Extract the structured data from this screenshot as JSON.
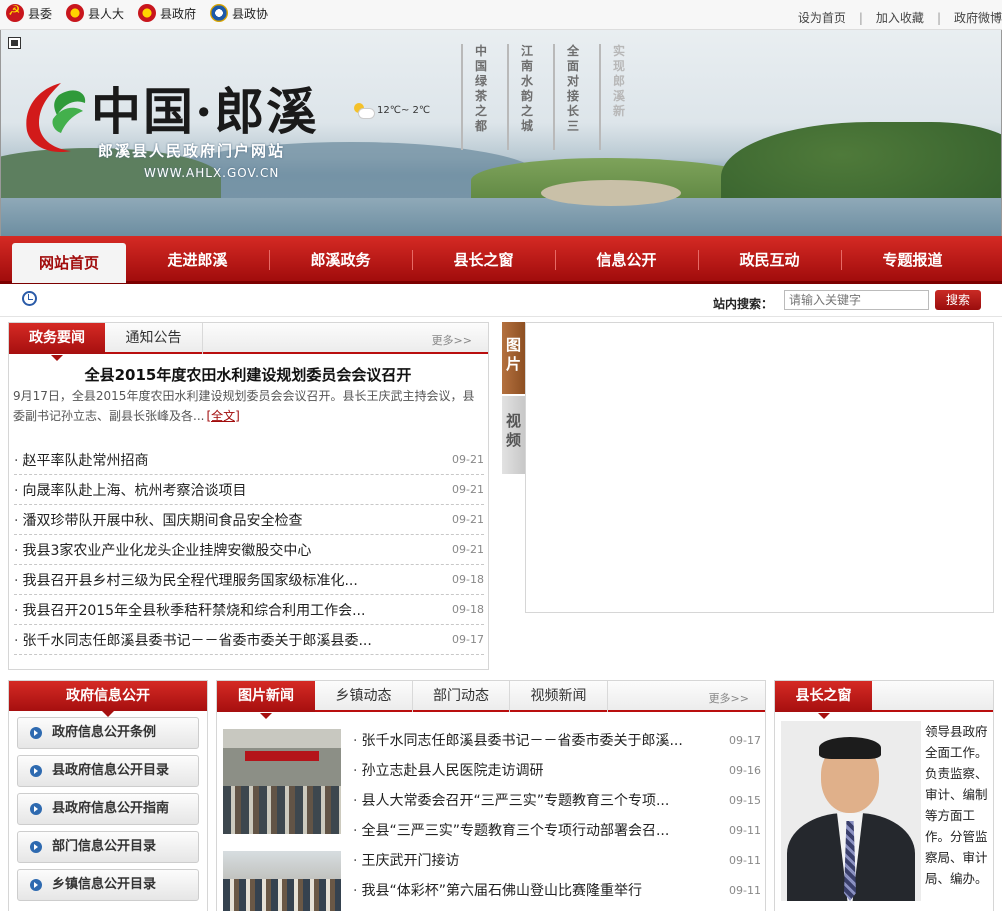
{
  "top_links": [
    {
      "label": "县委",
      "icon": "party-emblem-icon"
    },
    {
      "label": "县人大",
      "icon": "national-emblem-icon"
    },
    {
      "label": "县政府",
      "icon": "national-emblem-icon"
    },
    {
      "label": "县政协",
      "icon": "cppcc-emblem-icon"
    }
  ],
  "top_right": {
    "home": "设为首页",
    "favorite": "加入收藏",
    "weibo": "政府微博"
  },
  "banner": {
    "title": "中国·郎溪",
    "subtitle": "郎溪县人民政府门户网站",
    "url": "WWW.AHLX.GOV.CN",
    "weather": "12℃~ 2℃",
    "slogans": [
      "中国绿茶之都",
      "江南水韵之城",
      "全面对接长三",
      "实现郎溪新"
    ]
  },
  "nav": [
    "网站首页",
    "走进郎溪",
    "郎溪政务",
    "县长之窗",
    "信息公开",
    "政民互动",
    "专题报道"
  ],
  "search": {
    "label": "站内搜索：",
    "placeholder": "请输入关键字",
    "button": "搜索"
  },
  "news_panel": {
    "tabs": [
      "政务要闻",
      "通知公告"
    ],
    "more": "更多>>",
    "headline": "全县2015年度农田水利建设规划委员会会议召开",
    "summary": "9月17日，全县2015年度农田水利建设规划委员会会议召开。县长王庆武主持会议，县委副书记孙立志、副县长张峰及各...",
    "full_text": "[全文]",
    "items": [
      {
        "title": "赵平率队赴常州招商",
        "date": "09-21"
      },
      {
        "title": "向晟率队赴上海、杭州考察洽谈项目",
        "date": "09-21"
      },
      {
        "title": "潘双珍带队开展中秋、国庆期间食品安全检查",
        "date": "09-21"
      },
      {
        "title": "我县3家农业产业化龙头企业挂牌安徽股交中心",
        "date": "09-21"
      },
      {
        "title": "我县召开县乡村三级为民全程代理服务国家级标准化...",
        "date": "09-18"
      },
      {
        "title": "我县召开2015年全县秋季秸秆禁烧和综合利用工作会...",
        "date": "09-18"
      },
      {
        "title": "张千水同志任郎溪县委书记－－省委市委关于郎溪县委...",
        "date": "09-17"
      }
    ]
  },
  "media_tabs": [
    "图片",
    "视频"
  ],
  "gov_info": {
    "title": "政府信息公开",
    "items": [
      "政府信息公开条例",
      "县政府信息公开目录",
      "县政府信息公开指南",
      "部门信息公开目录",
      "乡镇信息公开目录"
    ]
  },
  "photo_news": {
    "tabs": [
      "图片新闻",
      "乡镇动态",
      "部门动态",
      "视频新闻"
    ],
    "more": "更多>>",
    "items": [
      {
        "title": "张千水同志任郎溪县委书记－－省委市委关于郎溪...",
        "date": "09-17"
      },
      {
        "title": "孙立志赴县人民医院走访调研",
        "date": "09-16"
      },
      {
        "title": "县人大常委会召开“三严三实”专题教育三个专项...",
        "date": "09-15"
      },
      {
        "title": "全县“三严三实”专题教育三个专项行动部署会召...",
        "date": "09-11"
      },
      {
        "title": "王庆武开门接访",
        "date": "09-11"
      },
      {
        "title": "我县“体彩杯”第六届石佛山登山比赛隆重举行",
        "date": "09-11"
      }
    ]
  },
  "county_window": {
    "title": "县长之窗",
    "bio": "领导县政府全面工作。负责监察、审计、编制等方面工作。分管监察局、审计局、编办。"
  }
}
